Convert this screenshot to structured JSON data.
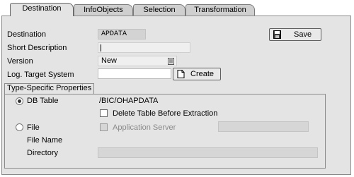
{
  "tabs": [
    {
      "label": "Destination",
      "active": true
    },
    {
      "label": "InfoObjects",
      "active": false
    },
    {
      "label": "Selection",
      "active": false
    },
    {
      "label": "Transformation",
      "active": false
    }
  ],
  "form": {
    "destination_label": "Destination",
    "destination_value": "APDATA",
    "short_description_label": "Short Description",
    "short_description_value": "",
    "version_label": "Version",
    "version_value": "New",
    "log_target_label": "Log. Target System",
    "log_target_value": ""
  },
  "buttons": {
    "save_label": "Save",
    "create_label": "Create"
  },
  "type_props": {
    "title": "Type-Specific Properties",
    "db_table_label": "DB Table",
    "db_table_value": "/BIC/OHAPDATA",
    "db_table_selected": true,
    "delete_before_extraction_label": "Delete Table Before Extraction",
    "delete_before_extraction_checked": false,
    "file_label": "File",
    "file_selected": false,
    "app_server_label": "Application Server",
    "app_server_checked": false,
    "app_server_value": "",
    "file_name_label": "File Name",
    "directory_label": "Directory",
    "directory_value": ""
  },
  "icons": {
    "save": "floppy-disk-icon",
    "create": "new-document-icon",
    "version_dropdown": "dropdown-list-icon"
  }
}
